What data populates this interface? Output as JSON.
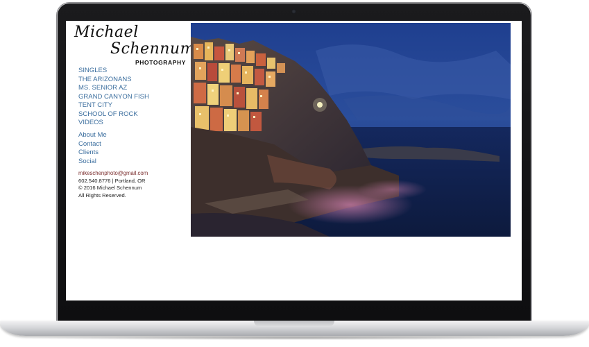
{
  "site": {
    "logo": {
      "line1": "Michael",
      "line2": "Schennum",
      "line3": "PHOTOGRAPHY"
    },
    "nav_primary": [
      {
        "label": "SINGLES"
      },
      {
        "label": "THE ARIZONANS"
      },
      {
        "label": "MS. SENIOR AZ"
      },
      {
        "label": "GRAND CANYON FISH"
      },
      {
        "label": "TENT CITY"
      },
      {
        "label": "SCHOOL OF ROCK"
      },
      {
        "label": "VIDEOS"
      }
    ],
    "nav_secondary": [
      {
        "label": "About Me"
      },
      {
        "label": "Contact"
      },
      {
        "label": "Clients"
      },
      {
        "label": "Social"
      }
    ],
    "footer": {
      "email": "mikeschenphoto@gmail.com",
      "phone_location": "602.540.8776 | Portland, OR",
      "copyright": "© 2016 Michael Schennum",
      "rights": "All Rights Reserved."
    },
    "colors": {
      "nav_link": "#3b6e9e",
      "email_link": "#7a2d2d",
      "text": "#222222"
    },
    "hero_image": {
      "icon": "coastal-village-night-photo"
    }
  }
}
